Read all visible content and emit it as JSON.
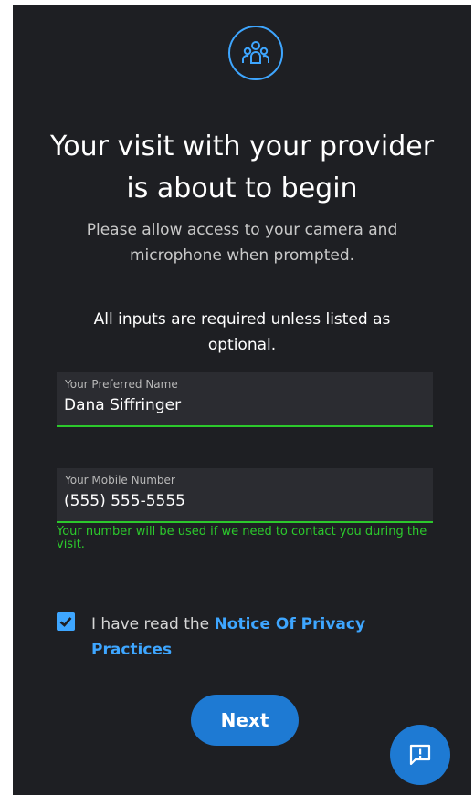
{
  "header": {
    "title": "Your visit with your provider is about to begin",
    "subtitle": "Please allow access to your camera and microphone when prompted.",
    "group_icon": "group-icon"
  },
  "form": {
    "required_note": "All inputs are required unless listed as optional.",
    "name_field": {
      "label": "Your Preferred Name",
      "value": "Dana Siffringer"
    },
    "phone_field": {
      "label": "Your Mobile Number",
      "value": "(555) 555-5555",
      "helper": "Your number will be used if we need to contact you during the visit."
    },
    "consent": {
      "checked": true,
      "prefix": "I have read the ",
      "link_text": "Notice Of Privacy Practices"
    },
    "next_label": "Next"
  },
  "chat_button": {
    "icon": "chat-alert-icon"
  },
  "colors": {
    "background": "#1e1f23",
    "accent": "#3ea6ff",
    "button": "#1e7ad3",
    "valid": "#2cc92c"
  }
}
